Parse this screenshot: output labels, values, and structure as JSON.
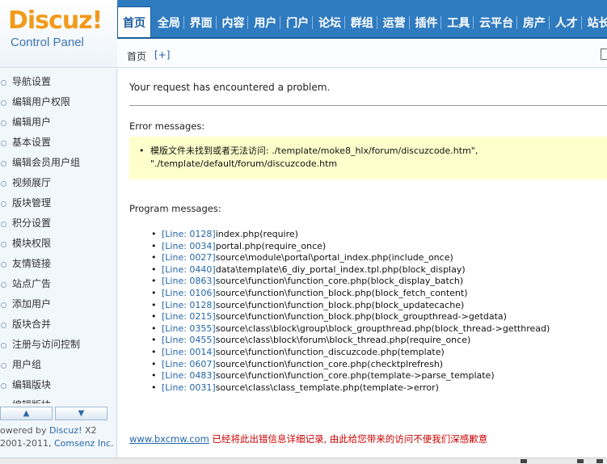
{
  "logo": {
    "brand": "Discuz",
    "bang": "!",
    "subtitle": "Control Panel"
  },
  "topnav": {
    "tabs": [
      {
        "label": "首页",
        "active": true
      },
      {
        "label": "全局"
      },
      {
        "label": "界面"
      },
      {
        "label": "内容"
      },
      {
        "label": "用户"
      },
      {
        "label": "门户"
      },
      {
        "label": "论坛"
      },
      {
        "label": "群组"
      },
      {
        "label": "运营"
      },
      {
        "label": "插件"
      },
      {
        "label": "工具"
      },
      {
        "label": "云平台"
      },
      {
        "label": "房产"
      },
      {
        "label": "人才"
      },
      {
        "label": "站长"
      }
    ]
  },
  "subbar": {
    "home": "首页",
    "plus": "[+]"
  },
  "sidebar": {
    "items": [
      "导航设置",
      "编辑用户权限",
      "编辑用户",
      "基本设置",
      "编辑会员用户组",
      "视频展厅",
      "版块管理",
      "积分设置",
      "模块权限",
      "友情链接",
      "站点广告",
      "添加用户",
      "版块合并",
      "注册与访问控制",
      "用户组",
      "编辑版块",
      "编辑版块"
    ],
    "up_label": "▲",
    "down_label": "▼"
  },
  "footer": {
    "line1_prefix": "owered by ",
    "line1_link": "Discuz!",
    "line1_suffix": " X2",
    "line2_prefix": "2001-2011, ",
    "line2_link": "Comsenz Inc."
  },
  "main": {
    "title": "Your request has encountered a problem.",
    "error_label": "Error messages:",
    "error_line1": "模版文件未找到或者无法访问: ./template/moke8_hlx/forum/discuzcode.htm\",",
    "error_line2": "\"./template/default/forum/discuzcode.htm",
    "program_label": "Program messages:",
    "program_lines": [
      {
        "ln": "[Line: 0128]",
        "text": "index.php(require)"
      },
      {
        "ln": "[Line: 0034]",
        "text": "portal.php(require_once)"
      },
      {
        "ln": "[Line: 0027]",
        "text": "source\\module\\portal\\portal_index.php(include_once)"
      },
      {
        "ln": "[Line: 0440]",
        "text": "data\\template\\6_diy_portal_index.tpl.php(block_display)"
      },
      {
        "ln": "[Line: 0863]",
        "text": "source\\function\\function_core.php(block_display_batch)"
      },
      {
        "ln": "[Line: 0106]",
        "text": "source\\function\\function_block.php(block_fetch_content)"
      },
      {
        "ln": "[Line: 0128]",
        "text": "source\\function\\function_block.php(block_updatecache)"
      },
      {
        "ln": "[Line: 0215]",
        "text": "source\\function\\function_block.php(block_groupthread->getdata)"
      },
      {
        "ln": "[Line: 0355]",
        "text": "source\\class\\block\\group\\block_groupthread.php(block_thread->getthread)"
      },
      {
        "ln": "[Line: 0455]",
        "text": "source\\class\\block\\forum\\block_thread.php(require_once)"
      },
      {
        "ln": "[Line: 0014]",
        "text": "source\\function\\function_discuzcode.php(template)"
      },
      {
        "ln": "[Line: 0607]",
        "text": "source\\function\\function_core.php(checktplrefresh)"
      },
      {
        "ln": "[Line: 0483]",
        "text": "source\\function\\function_core.php(template->parse_template)"
      },
      {
        "ln": "[Line: 0031]",
        "text": "source\\class\\class_template.php(template->error)"
      }
    ],
    "bottom_link": "www.bxcmw.com",
    "bottom_red": " 已经将此出错信息详细记录, 由此给您带来的访问不便我们深感歉意"
  }
}
